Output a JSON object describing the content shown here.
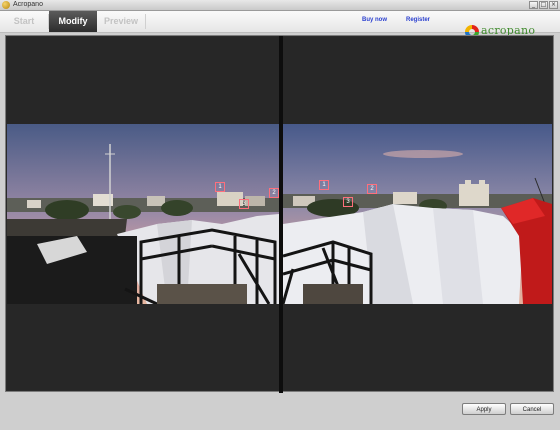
{
  "window": {
    "title": "Acropano",
    "controls": [
      "_",
      "□",
      "×"
    ]
  },
  "tabs": [
    {
      "label": "Start",
      "active": false
    },
    {
      "label": "Modify",
      "active": true
    },
    {
      "label": "Preview",
      "active": false
    }
  ],
  "links": {
    "buy": "Buy now",
    "register": "Register"
  },
  "logo": {
    "text": "acropano",
    "colors": [
      "#e2231a",
      "#3ca52e",
      "#2175c7",
      "#f2b300"
    ]
  },
  "control_points": {
    "left": [
      "1",
      "2",
      "3"
    ],
    "right": [
      "1",
      "2",
      "3"
    ]
  },
  "buttons": {
    "apply": "Apply",
    "cancel": "Cancel"
  }
}
